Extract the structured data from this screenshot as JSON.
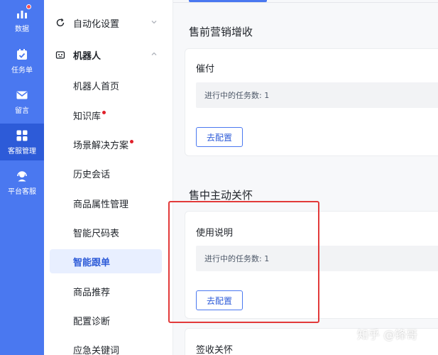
{
  "rail": {
    "items": [
      {
        "label": "数据",
        "icon": "bar-chart-icon"
      },
      {
        "label": "任务单",
        "icon": "calendar-check-icon"
      },
      {
        "label": "留言",
        "icon": "mail-icon"
      },
      {
        "label": "客服管理",
        "icon": "grid-icon"
      },
      {
        "label": "平台客服",
        "icon": "headset-icon"
      }
    ],
    "active_index": 3
  },
  "menu": {
    "group_automation": "自动化设置",
    "group_robot": "机器人",
    "items": [
      "机器人首页",
      "知识库",
      "场景解决方案",
      "历史会话",
      "商品属性管理",
      "智能尺码表",
      "智能跟单",
      "商品推荐",
      "配置诊断",
      "应急关键词"
    ],
    "active_item": "智能跟单"
  },
  "main": {
    "sections": [
      {
        "title": "售前营销增收",
        "card_title": "催付",
        "task_text": "进行中的任务数: 1",
        "button": "去配置"
      },
      {
        "title": "售中主动关怀",
        "card_title": "使用说明",
        "task_text": "进行中的任务数: 1",
        "button": "去配置"
      }
    ],
    "partial_card_title": "签收关怀"
  },
  "watermark": "知乎 @锋哥",
  "colors": {
    "rail": "#4a78f0",
    "accent": "#2d5bd8",
    "highlight": "#e23a3a"
  }
}
